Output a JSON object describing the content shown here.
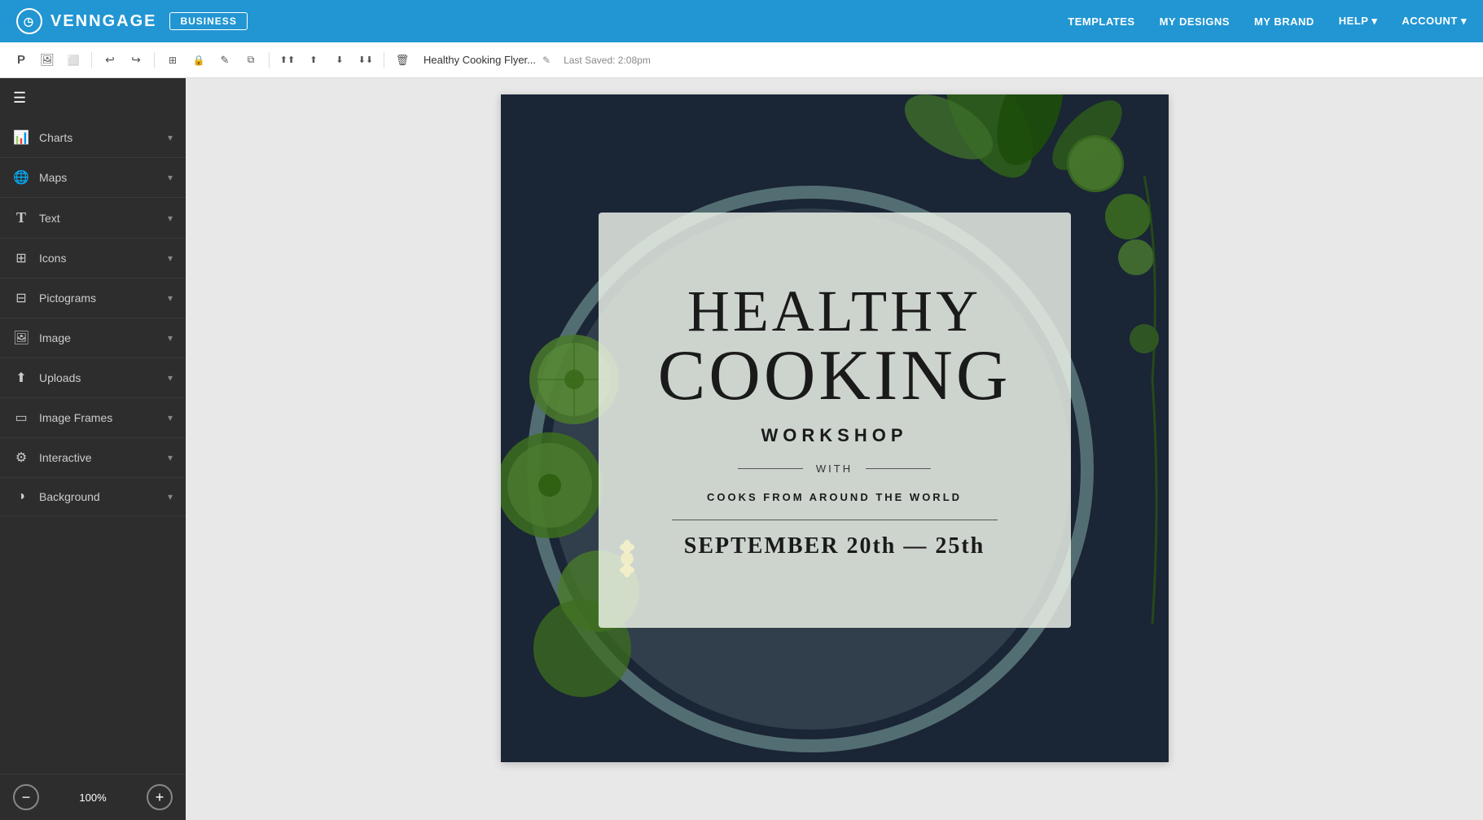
{
  "app": {
    "name": "VENNGAGE",
    "badge": "BUSINESS",
    "logo_symbol": "◷"
  },
  "top_nav": {
    "links": [
      {
        "id": "templates",
        "label": "TEMPLATES"
      },
      {
        "id": "my_designs",
        "label": "MY DESIGNS"
      },
      {
        "id": "my_brand",
        "label": "MY BRAND"
      },
      {
        "id": "help",
        "label": "HELP ▾"
      },
      {
        "id": "account",
        "label": "ACCOUNT ▾"
      }
    ]
  },
  "toolbar": {
    "doc_title": "Healthy Cooking Flyer...",
    "last_saved": "Last Saved: 2:08pm",
    "buttons": [
      {
        "id": "logo",
        "icon": "🅿",
        "tooltip": "Logo"
      },
      {
        "id": "image-upload",
        "icon": "🖼",
        "tooltip": "Upload Image"
      },
      {
        "id": "undo",
        "icon": "↩",
        "tooltip": "Undo"
      },
      {
        "id": "redo",
        "icon": "↪",
        "tooltip": "Redo"
      },
      {
        "id": "resize",
        "icon": "⊞",
        "tooltip": "Resize"
      },
      {
        "id": "lock",
        "icon": "🔒",
        "tooltip": "Lock"
      },
      {
        "id": "edit",
        "icon": "✎",
        "tooltip": "Edit"
      },
      {
        "id": "copy",
        "icon": "⧉",
        "tooltip": "Copy"
      },
      {
        "id": "bring-front",
        "icon": "⬆⬆",
        "tooltip": "Bring to Front"
      },
      {
        "id": "bring-up",
        "icon": "⬆",
        "tooltip": "Bring Forward"
      },
      {
        "id": "send-down",
        "icon": "⬇",
        "tooltip": "Send Backward"
      },
      {
        "id": "send-back",
        "icon": "⬇⬇",
        "tooltip": "Send to Back"
      },
      {
        "id": "delete",
        "icon": "🗑",
        "tooltip": "Delete"
      }
    ]
  },
  "sidebar": {
    "items": [
      {
        "id": "charts",
        "label": "Charts",
        "icon": "📊"
      },
      {
        "id": "maps",
        "label": "Maps",
        "icon": "🌐"
      },
      {
        "id": "text",
        "label": "Text",
        "icon": "T"
      },
      {
        "id": "icons",
        "label": "Icons",
        "icon": "⊞"
      },
      {
        "id": "pictograms",
        "label": "Pictograms",
        "icon": "⊟"
      },
      {
        "id": "image",
        "label": "Image",
        "icon": "🖼"
      },
      {
        "id": "uploads",
        "label": "Uploads",
        "icon": "⬆"
      },
      {
        "id": "image-frames",
        "label": "Image Frames",
        "icon": "▭"
      },
      {
        "id": "interactive",
        "label": "Interactive",
        "icon": "⚙"
      },
      {
        "id": "background",
        "label": "Background",
        "icon": "◑"
      }
    ],
    "zoom_minus": "−",
    "zoom_level": "100%",
    "zoom_plus": "+"
  },
  "canvas": {
    "title_line1": "HEALTHY",
    "title_line2": "COOKING",
    "subtitle": "WORKSHOP",
    "divider_text": "WITH",
    "tagline": "COOKS FROM AROUND THE WORLD",
    "date": "SEPTEMBER 20th — 25th"
  }
}
